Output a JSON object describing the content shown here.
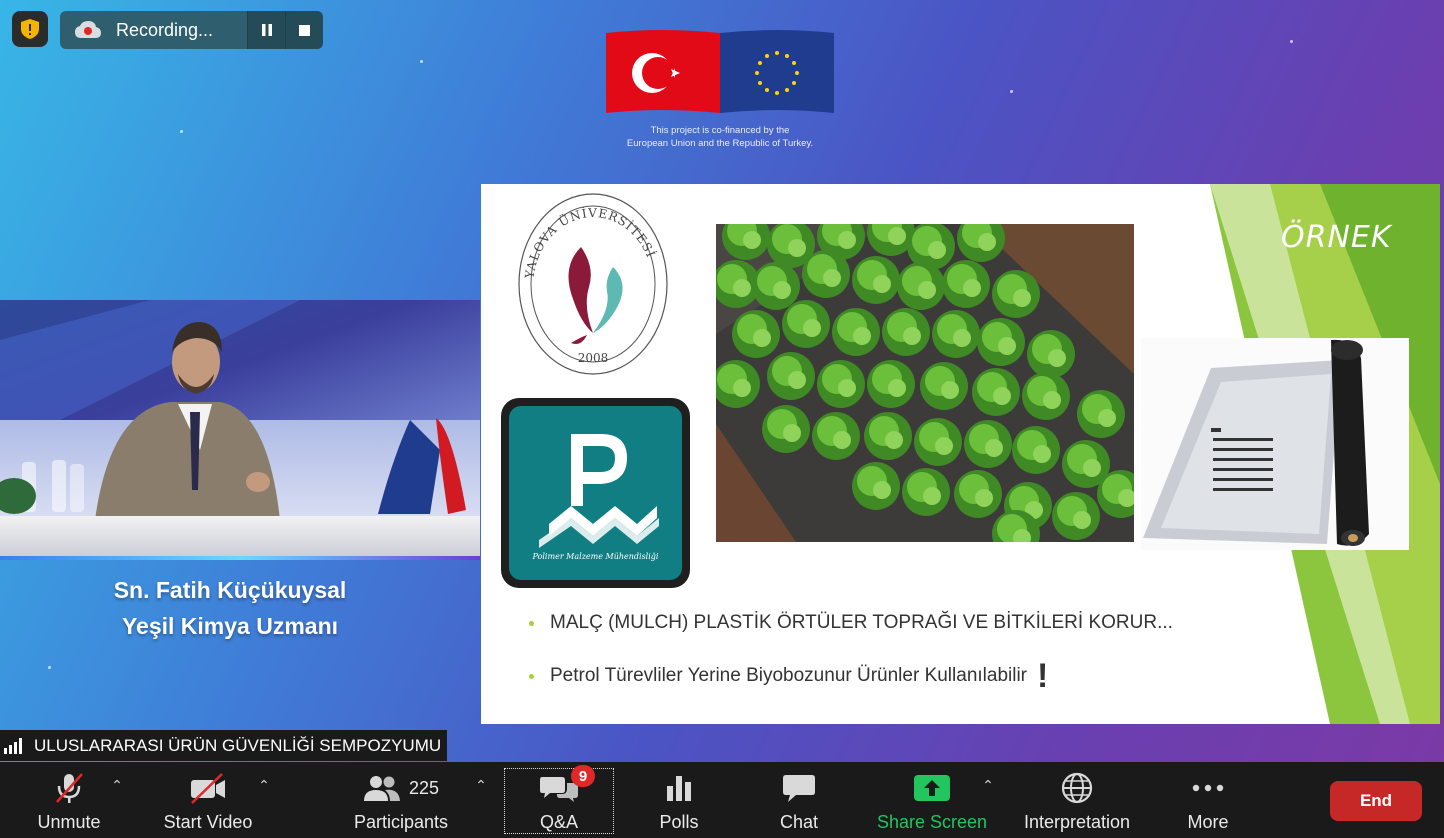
{
  "recording": {
    "label": "Recording..."
  },
  "funding": {
    "line1": "This project is co-financed by the",
    "line2": "European Union and the Republic of Turkey."
  },
  "speaker": {
    "name": "Sn. Fatih Küçükuysal",
    "role": "Yeşil Kimya Uzmanı"
  },
  "slide": {
    "heading": "ÖRNEK",
    "logo_yalova_text": "YALOVA ÜNİVERSİTESİ",
    "logo_yalova_year": "2008",
    "logo_pm_text": "Polimer Malzeme Mühendisliği",
    "bullets": [
      "MALÇ (MULCH) PLASTİK ÖRTÜLER TOPRAĞI VE BİTKİLERİ KORUR...",
      "Petrol Türevliler Yerine Biyobozunur Ürünler Kullanılabilir"
    ],
    "bullet2_mark": "!"
  },
  "meeting": {
    "title": "ULUSLARARASI ÜRÜN GÜVENLİĞİ SEMPOZYUMU"
  },
  "toolbar": {
    "unmute": "Unmute",
    "start_video": "Start Video",
    "participants": "Participants",
    "participants_count": "225",
    "qa": "Q&A",
    "qa_badge": "9",
    "polls": "Polls",
    "chat": "Chat",
    "share_screen": "Share Screen",
    "interpretation": "Interpretation",
    "more": "More",
    "end": "End"
  },
  "colors": {
    "accent_green": "#22c55e",
    "end_red": "#c62828",
    "toolbar_bg": "#1a1a1a"
  }
}
